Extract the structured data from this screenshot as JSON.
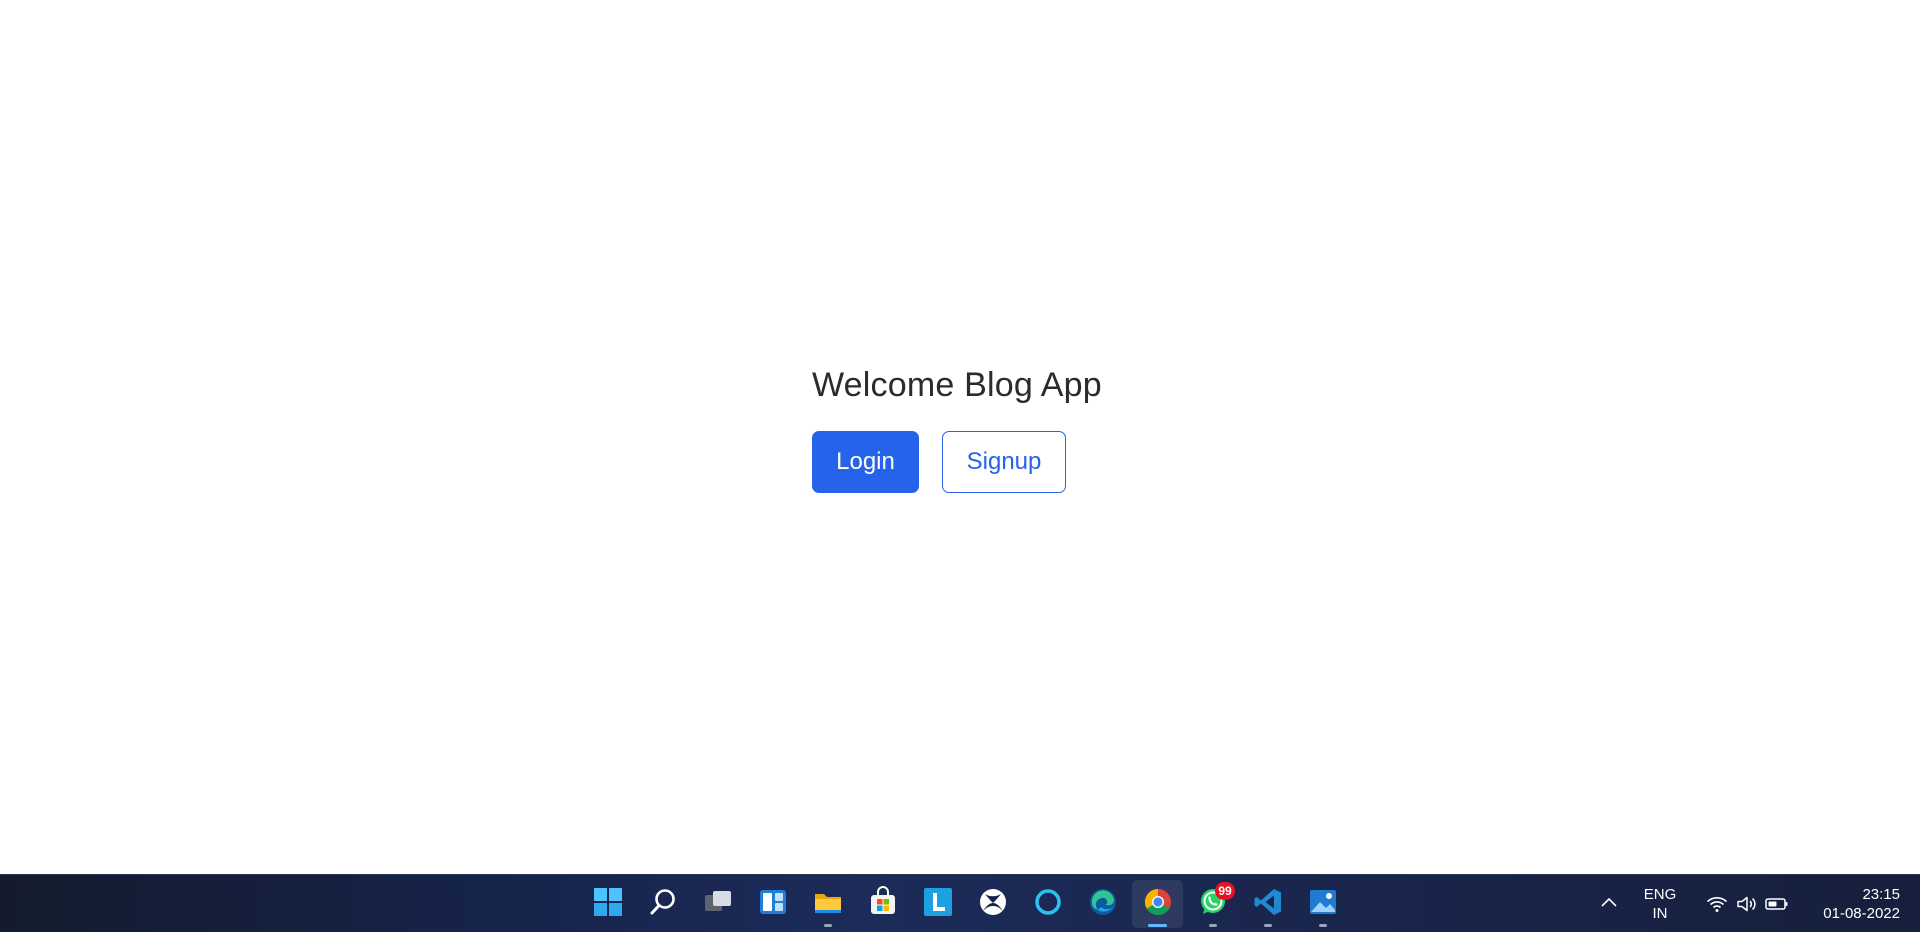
{
  "page": {
    "title": "Welcome Blog App",
    "login_label": "Login",
    "signup_label": "Signup"
  },
  "taskbar": {
    "apps": [
      {
        "name": "start-button",
        "icon": "windows-logo-icon"
      },
      {
        "name": "search-button",
        "icon": "search-icon"
      },
      {
        "name": "task-view-button",
        "icon": "task-view-icon"
      },
      {
        "name": "widgets-button",
        "icon": "widgets-icon"
      },
      {
        "name": "file-explorer-button",
        "icon": "folder-icon",
        "running": true
      },
      {
        "name": "microsoft-store-button",
        "icon": "store-icon"
      },
      {
        "name": "l-app-button",
        "icon": "l-app-icon"
      },
      {
        "name": "xbox-button",
        "icon": "xbox-icon"
      },
      {
        "name": "cortana-button",
        "icon": "cortana-icon"
      },
      {
        "name": "edge-button",
        "icon": "edge-icon"
      },
      {
        "name": "chrome-button",
        "icon": "chrome-icon",
        "running": true,
        "active": true
      },
      {
        "name": "whatsapp-button",
        "icon": "whatsapp-icon",
        "running": true,
        "badge": "99"
      },
      {
        "name": "vscode-button",
        "icon": "vscode-icon",
        "running": true
      },
      {
        "name": "photos-button",
        "icon": "photos-icon",
        "running": true
      }
    ],
    "language_line1": "ENG",
    "language_line2": "IN",
    "time": "23:15",
    "date": "01-08-2022"
  },
  "colors": {
    "primary": "#2563eb",
    "taskbar_bg": "#16234a",
    "badge": "#e81123"
  }
}
